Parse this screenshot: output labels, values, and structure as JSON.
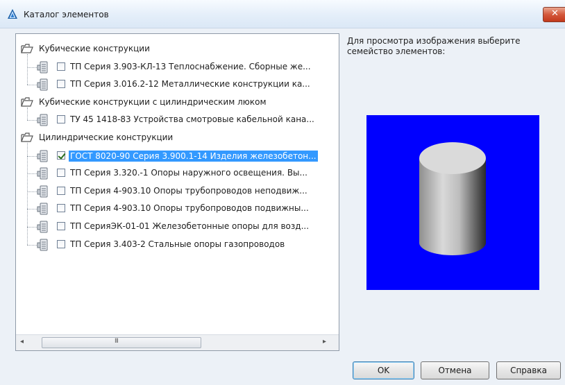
{
  "window": {
    "title": "Каталог элементов"
  },
  "icons": {
    "app": "autocad-icon",
    "close": "close-icon",
    "folder": "open-folder-icon",
    "item": "element-family-icon"
  },
  "colors": {
    "selection": "#3399ff",
    "preview_background": "#0000ff",
    "close_button": "#c8452a"
  },
  "tree": {
    "groups": [
      {
        "label": "Кубические конструкции",
        "items": [
          {
            "label": "ТП Серия 3.903-КЛ-13 Теплоснабжение. Сборные же...",
            "checked": false,
            "selected": false
          },
          {
            "label": "ТП Серия 3.016.2-12 Металлические конструкции ка...",
            "checked": false,
            "selected": false
          }
        ]
      },
      {
        "label": "Кубические конструкции с цилиндрическим люком",
        "items": [
          {
            "label": "ТУ 45 1418-83 Устройства смотровые кабельной кана...",
            "checked": false,
            "selected": false
          }
        ]
      },
      {
        "label": "Цилиндрические конструкции",
        "items": [
          {
            "label": "ГОСТ 8020-90 Серия 3.900.1-14 Изделия железобетон...",
            "checked": true,
            "selected": true
          },
          {
            "label": "ТП Серия 3.320.-1 Опоры наружного освещения. Вы...",
            "checked": false,
            "selected": false
          },
          {
            "label": "ТП Серия 4-903.10 Опоры трубопроводов неподвиж...",
            "checked": false,
            "selected": false
          },
          {
            "label": "ТП Серия 4-903.10 Опоры трубопроводов подвижны...",
            "checked": false,
            "selected": false
          },
          {
            "label": "ТП СерияЭК-01-01 Железобетонные опоры для возд...",
            "checked": false,
            "selected": false
          },
          {
            "label": "ТП Серия 3.403-2 Стальные опоры газопроводов",
            "checked": false,
            "selected": false
          }
        ]
      }
    ]
  },
  "scrollbar": {
    "left_arrow": "◂",
    "right_arrow": "▸",
    "grip": "III"
  },
  "preview": {
    "hint": "Для просмотра изображения выберите семейство элементов:"
  },
  "buttons": {
    "ok": "OK",
    "cancel": "Отмена",
    "help": "Справка"
  }
}
